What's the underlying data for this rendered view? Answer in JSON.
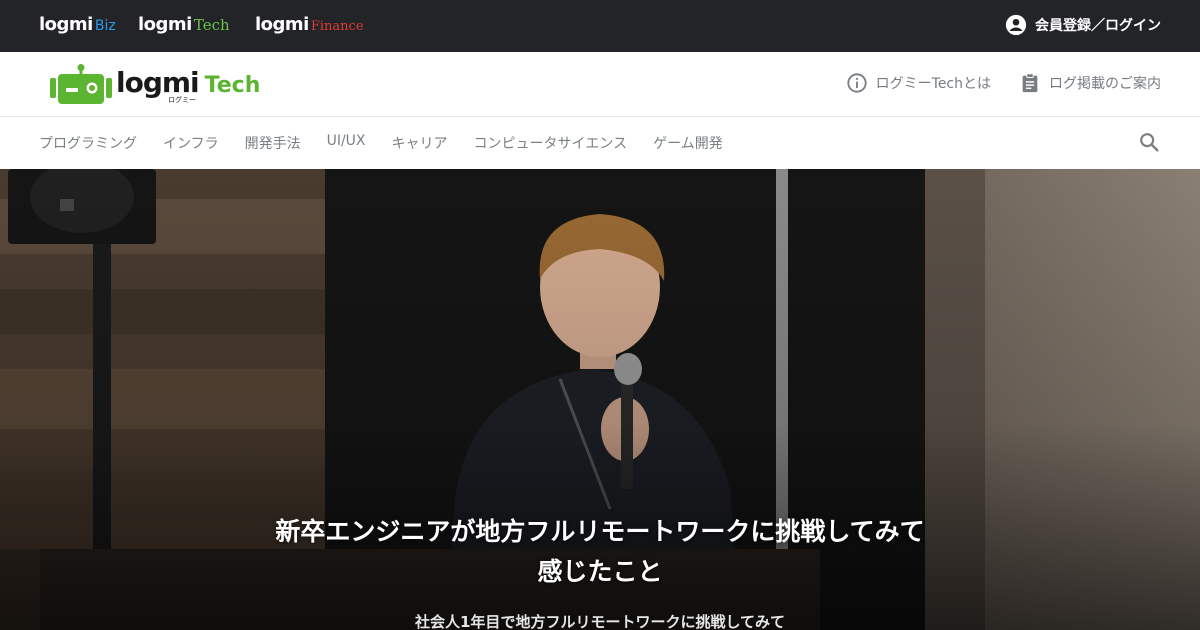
{
  "topbar": {
    "brands": [
      {
        "name": "logmi",
        "suffix": "Biz"
      },
      {
        "name": "logmi",
        "suffix": "Tech"
      },
      {
        "name": "logmi",
        "suffix": "Finance"
      }
    ],
    "login_label": "会員登録／ログイン"
  },
  "header": {
    "logo_main": "logmi",
    "logo_accent": "Tech",
    "logo_kana": "ログミー",
    "links": [
      {
        "label": "ログミーTechとは",
        "icon": "info-icon"
      },
      {
        "label": "ログ掲載のご案内",
        "icon": "clipboard-icon"
      }
    ]
  },
  "nav": {
    "categories": [
      "プログラミング",
      "インフラ",
      "開発手法",
      "UI/UX",
      "キャリア",
      "コンピュータサイエンス",
      "ゲーム開発"
    ],
    "search_icon": "search-icon"
  },
  "hero": {
    "title_line1": "新卒エンジニアが地方フルリモートワークに挑戦してみて",
    "title_line2": "感じたこと",
    "subtitle": "社会人1年目で地方フルリモートワークに挑戦してみて"
  },
  "colors": {
    "topbar_bg": "#222427",
    "biz": "#2b9be8",
    "tech": "#6cc24a",
    "finance": "#e03c31",
    "nav_text": "#7b8085"
  }
}
